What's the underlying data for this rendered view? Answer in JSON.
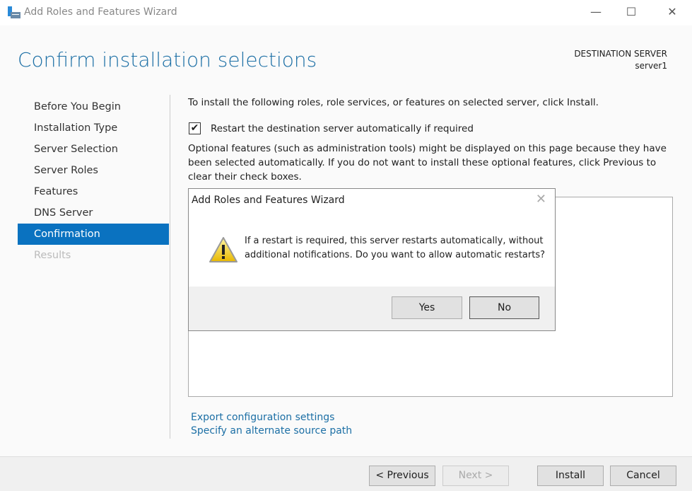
{
  "window": {
    "title": "Add Roles and Features Wizard",
    "minimize": "—",
    "maximize": "☐",
    "close": "✕"
  },
  "header": {
    "title": "Confirm installation selections",
    "destination_label": "DESTINATION SERVER",
    "destination_server": "server1"
  },
  "sidebar": {
    "items": [
      {
        "label": "Before You Begin",
        "state": "normal"
      },
      {
        "label": "Installation Type",
        "state": "normal"
      },
      {
        "label": "Server Selection",
        "state": "normal"
      },
      {
        "label": "Server Roles",
        "state": "normal"
      },
      {
        "label": "Features",
        "state": "normal"
      },
      {
        "label": "DNS Server",
        "state": "normal"
      },
      {
        "label": "Confirmation",
        "state": "selected"
      },
      {
        "label": "Results",
        "state": "disabled"
      }
    ]
  },
  "main": {
    "intro": "To install the following roles, role services, or features on selected server, click Install.",
    "restart_checkbox": {
      "label": "Restart the destination server automatically if required",
      "checked": true
    },
    "optional_note": "Optional features (such as administration tools) might be displayed on this page because they have been selected automatically. If you do not want to install these optional features, click Previous to clear their check boxes.",
    "links": {
      "export": "Export configuration settings",
      "alternate_source": "Specify an alternate source path"
    }
  },
  "footer": {
    "previous": "< Previous",
    "next": "Next >",
    "install": "Install",
    "cancel": "Cancel"
  },
  "dialog": {
    "title": "Add Roles and Features Wizard",
    "close": "✕",
    "icon": "warning-icon",
    "message": "If a restart is required, this server restarts automatically, without additional notifications. Do you want to allow automatic restarts?",
    "yes": "Yes",
    "no": "No"
  },
  "colors": {
    "accent": "#0a72c0",
    "heading": "#1c6fa5"
  }
}
